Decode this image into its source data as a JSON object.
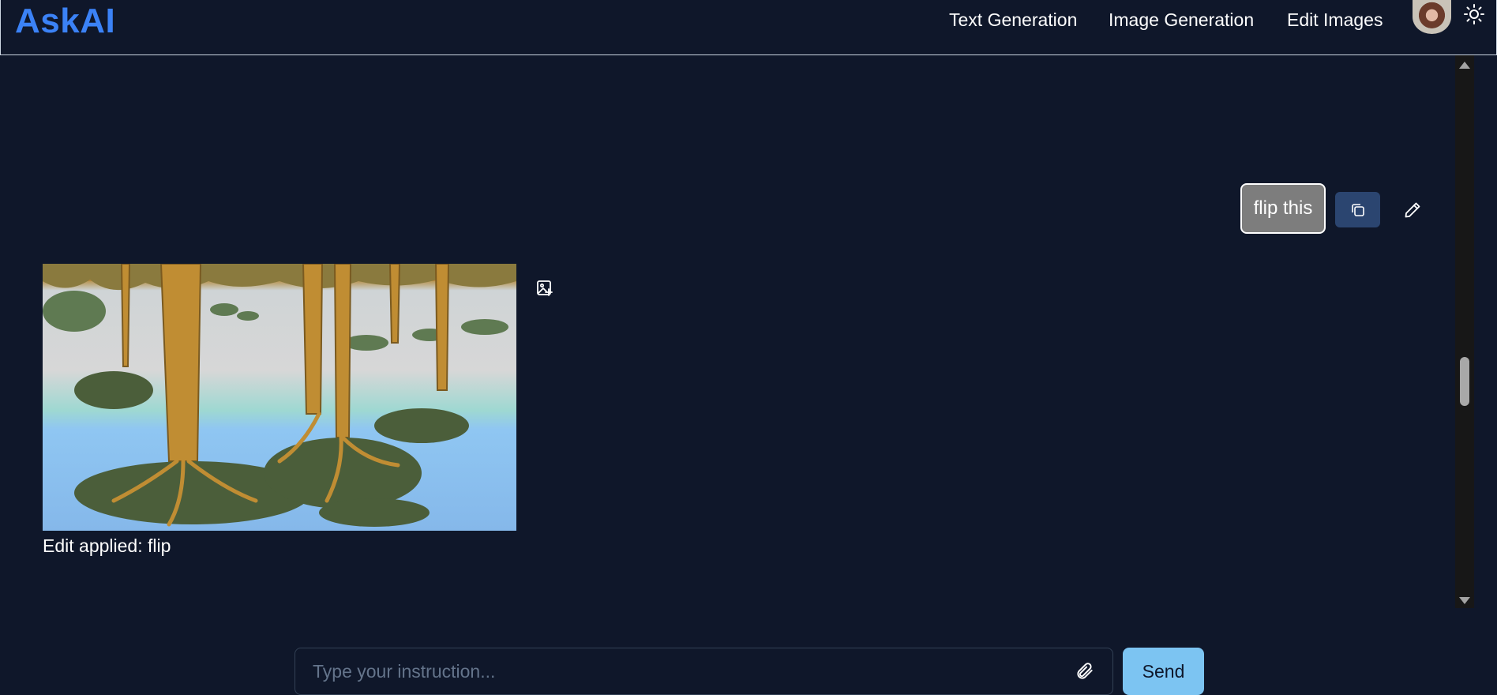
{
  "app": {
    "title": "AskAI"
  },
  "nav": {
    "items": [
      {
        "label": "Text Generation"
      },
      {
        "label": "Image Generation"
      },
      {
        "label": "Edit Images"
      }
    ]
  },
  "icons": {
    "theme_toggle": "sun-icon",
    "copy": "copy-icon",
    "edit": "pencil-icon",
    "image_edit": "image-edit-icon",
    "attach": "paperclip-icon"
  },
  "colors": {
    "background": "#0f172a",
    "brand": "#3b82f6",
    "copy_button": "#2b4570",
    "send_button": "#7cc4f2",
    "user_bubble": "#7d7d7d"
  },
  "messages": {
    "user": {
      "text": "flip this"
    },
    "assistant": {
      "caption": "Edit applied: flip"
    }
  },
  "composer": {
    "placeholder": "Type your instruction...",
    "value": "",
    "send_label": "Send"
  }
}
